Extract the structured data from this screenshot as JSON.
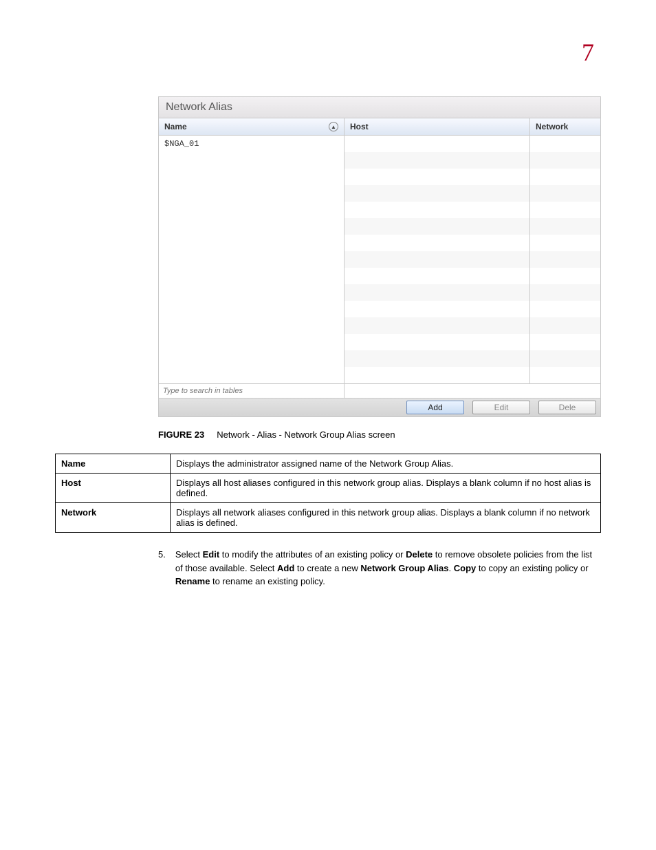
{
  "page_number": "7",
  "panel": {
    "title": "Network Alias",
    "columns": {
      "name": "Name",
      "host": "Host",
      "network": "Network"
    },
    "rows": [
      {
        "name": "$NGA_01",
        "host": "",
        "network": ""
      }
    ],
    "search_placeholder": "Type to search in tables",
    "buttons": {
      "add": "Add",
      "edit": "Edit",
      "delete": "Dele"
    }
  },
  "figure": {
    "label": "FIGURE 23",
    "caption": "Network - Alias - Network Group Alias screen"
  },
  "desc": {
    "name_label": "Name",
    "name_text": "Displays the administrator assigned name of the Network Group Alias.",
    "host_label": "Host",
    "host_text": "Displays all host aliases configured in this network group alias. Displays a blank column if no host alias is defined.",
    "network_label": "Network",
    "network_text": "Displays all network aliases configured in this network group alias. Displays a blank column if no network alias is defined."
  },
  "step": {
    "num": "5.",
    "t1": "Select ",
    "b1": "Edit",
    "t2": " to modify the attributes of an existing policy or ",
    "b2": "Delete",
    "t3": " to remove obsolete policies from the list of those available. Select ",
    "b3": "Add",
    "t4": " to create a new ",
    "b4": "Network Group Alias",
    "t5": ". ",
    "b5": "Copy",
    "t6": " to copy an existing policy or ",
    "b6": "Rename",
    "t7": " to rename an existing policy."
  }
}
